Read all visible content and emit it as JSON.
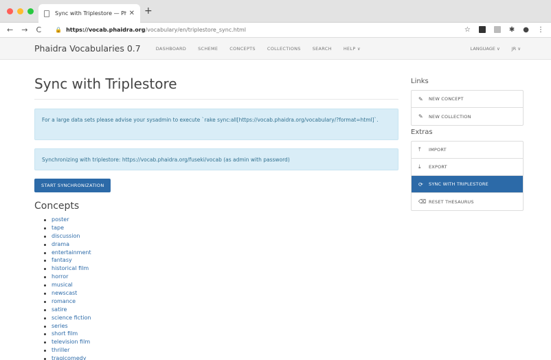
{
  "browser": {
    "tab_title": "Sync with Triplestore — Phaid",
    "url_host": "https://vocab.phaidra.org",
    "url_path": "/vocabulary/en/triplestore_sync.html"
  },
  "navbar": {
    "brand": "Phaidra Vocabularies 0.7",
    "links": [
      "DASHBOARD",
      "SCHEME",
      "CONCEPTS",
      "COLLECTIONS",
      "SEARCH",
      "HELP ∨"
    ],
    "right": [
      "LANGUAGE ∨",
      "JR ∨"
    ]
  },
  "main": {
    "title": "Sync with Triplestore",
    "alert1": "For a large data sets please advise your sysadmin to execute `rake sync:all[https://vocab.phaidra.org/vocabulary/?format=html]`.",
    "alert2": "Synchronizing with triplestore: https://vocab.phaidra.org/fuseki/vocab (as admin with password)",
    "sync_button": "START SYNCHRONIZATION",
    "concepts_title": "Concepts",
    "concepts": [
      "poster",
      "tape",
      "discussion",
      "drama",
      "entertainment",
      "fantasy",
      "historical film",
      "horror",
      "musical",
      "newscast",
      "romance",
      "satire",
      "science fiction",
      "series",
      "short film",
      "television film",
      "thriller",
      "tragicomedy"
    ]
  },
  "sidebar": {
    "links_heading": "Links",
    "links": [
      {
        "icon": "edit-icon",
        "glyph": "✎",
        "label": "NEW CONCEPT"
      },
      {
        "icon": "edit-icon",
        "glyph": "✎",
        "label": "NEW COLLECTION"
      }
    ],
    "extras_heading": "Extras",
    "extras": [
      {
        "icon": "upload-icon",
        "glyph": "⤒",
        "label": "IMPORT"
      },
      {
        "icon": "download-icon",
        "glyph": "⤓",
        "label": "EXPORT"
      },
      {
        "icon": "refresh-icon",
        "glyph": "⟳",
        "label": "SYNC WITH TRIPLESTORE"
      },
      {
        "icon": "eraser-icon",
        "glyph": "⌫",
        "label": "RESET THESAURUS"
      }
    ]
  },
  "colors": {
    "accent": "#2c6aa8",
    "alert_bg": "#d9edf7",
    "alert_text": "#31708f"
  }
}
